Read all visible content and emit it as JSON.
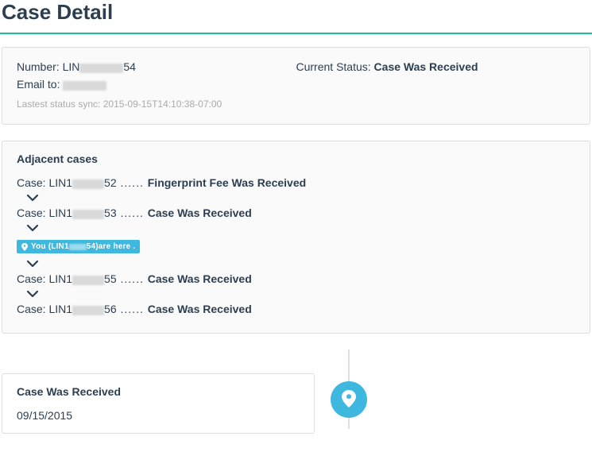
{
  "page": {
    "title": "Case Detail"
  },
  "info": {
    "number_label": "Number: LIN",
    "number_suffix": "54",
    "email_label": "Email to: ",
    "status_label": "Current Status: ",
    "status_value": "Case Was Received",
    "sync_prefix": "Lastest status sync: ",
    "sync_value": "2015-09-15T14:10:38-07:00"
  },
  "adjacent": {
    "title": "Adjacent cases",
    "items": [
      {
        "prefix": "Case: LIN1",
        "suffix": "52",
        "status": "Fingerprint Fee Was Received"
      },
      {
        "prefix": "Case: LIN1",
        "suffix": "53",
        "status": "Case Was Received"
      },
      {
        "prefix": "Case: LIN1",
        "suffix": "55",
        "status": "Case Was Received"
      },
      {
        "prefix": "Case: LIN1",
        "suffix": "56",
        "status": "Case Was Received"
      }
    ],
    "you_marker": {
      "pre": "You (LIN1",
      "suffix": "54)",
      "post": " are here ."
    }
  },
  "timeline": {
    "event": {
      "title": "Case Was Received",
      "date": "09/15/2015"
    }
  },
  "colors": {
    "accent_teal": "#1abc9c",
    "badge_blue": "#3fb8df"
  },
  "icons": {
    "chevron_down": "chevron-down-icon",
    "pin": "pin-icon"
  }
}
